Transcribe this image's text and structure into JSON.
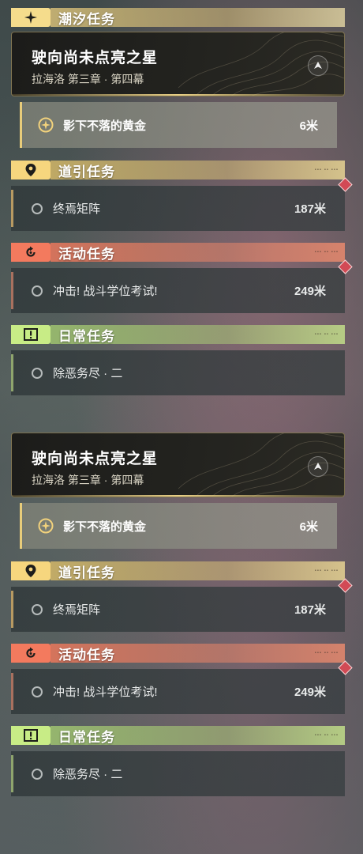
{
  "panel_top": {
    "header": {
      "title": "潮汐任务"
    },
    "main_quest": {
      "title": "驶向尚未点亮之星",
      "subtitle": "拉海洛 第三章 · 第四幕"
    },
    "tracked": {
      "name": "影下不落的黄金",
      "distance": "6米"
    },
    "guide": {
      "title": "道引任务",
      "quest": {
        "name": "终焉矩阵",
        "distance": "187米"
      }
    },
    "event": {
      "title": "活动任务",
      "quest": {
        "name": "冲击! 战斗学位考试!",
        "distance": "249米"
      }
    },
    "daily": {
      "title": "日常任务",
      "quest": {
        "name": "除恶务尽 · 二"
      }
    }
  },
  "panel_bottom": {
    "main_quest": {
      "title": "驶向尚未点亮之星",
      "subtitle": "拉海洛 第三章 · 第四幕"
    },
    "tracked": {
      "name": "影下不落的黄金",
      "distance": "6米"
    },
    "guide": {
      "title": "道引任务",
      "quest": {
        "name": "终焉矩阵",
        "distance": "187米"
      }
    },
    "event": {
      "title": "活动任务",
      "quest": {
        "name": "冲击! 战斗学位考试!",
        "distance": "249米"
      }
    },
    "daily": {
      "title": "日常任务",
      "quest": {
        "name": "除恶务尽 · 二"
      }
    }
  },
  "colors": {
    "tide": "#f5dc8c",
    "guide": "#f6d67e",
    "event": "#f37a5e",
    "daily": "#c8ec86",
    "alert_marker": "#d24a55"
  },
  "icons": {
    "tide": "sparkle-icon",
    "guide": "location-pin-icon",
    "event": "refresh-arrow-icon",
    "daily": "exclamation-box-icon",
    "tracked": "compass-star-icon",
    "main_action": "navigation-arrow-icon"
  }
}
